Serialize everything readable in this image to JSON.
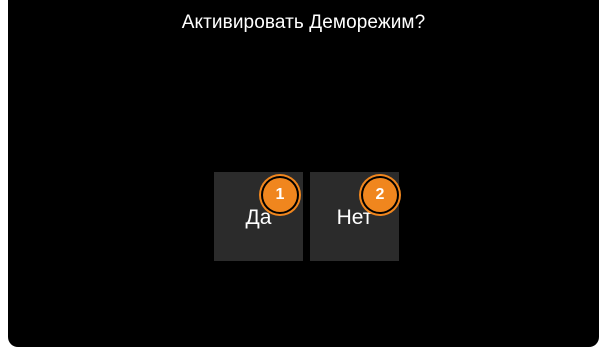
{
  "dialog": {
    "title": "Активировать Деморежим?"
  },
  "buttons": {
    "yes_label": "Да",
    "no_label": "Нет"
  },
  "callouts": {
    "first": "1",
    "second": "2"
  },
  "colors": {
    "screen_background": "#000000",
    "button_background": "#2b2b2b",
    "callout_accent": "#f0861e",
    "text": "#ffffff"
  }
}
